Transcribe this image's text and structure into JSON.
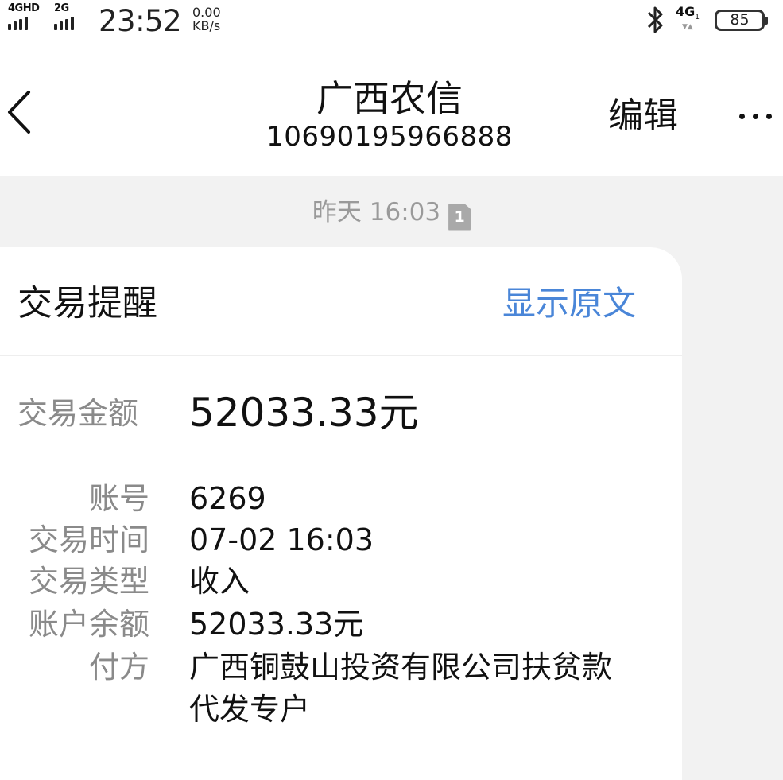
{
  "status_bar": {
    "signal1_label": "4GHD",
    "signal2_label": "2G",
    "time": "23:52",
    "net_speed_value": "0.00",
    "net_speed_unit": "KB/s",
    "network_label": "4G",
    "network_sub": "1",
    "battery": "85"
  },
  "header": {
    "title": "广西农信",
    "number": "10690195966888",
    "edit_label": "编辑"
  },
  "message": {
    "timestamp": "昨天 16:03",
    "sim_badge": "1"
  },
  "card": {
    "title": "交易提醒",
    "show_original": "显示原文",
    "amount_label": "交易金额",
    "amount_value": "52033.33元",
    "fields": [
      {
        "label": "账号",
        "value": "6269"
      },
      {
        "label": "交易时间",
        "value": "07-02 16:03"
      },
      {
        "label": "交易类型",
        "value": "收入"
      },
      {
        "label": "账户余额",
        "value": "52033.33元"
      },
      {
        "label": "付方",
        "value": "广西铜鼓山投资有限公司扶贫款代发专户"
      }
    ]
  },
  "colors": {
    "link_blue": "#4a86d8",
    "label_gray": "#8a8a8a",
    "timestamp_gray": "#9a9a9a"
  }
}
